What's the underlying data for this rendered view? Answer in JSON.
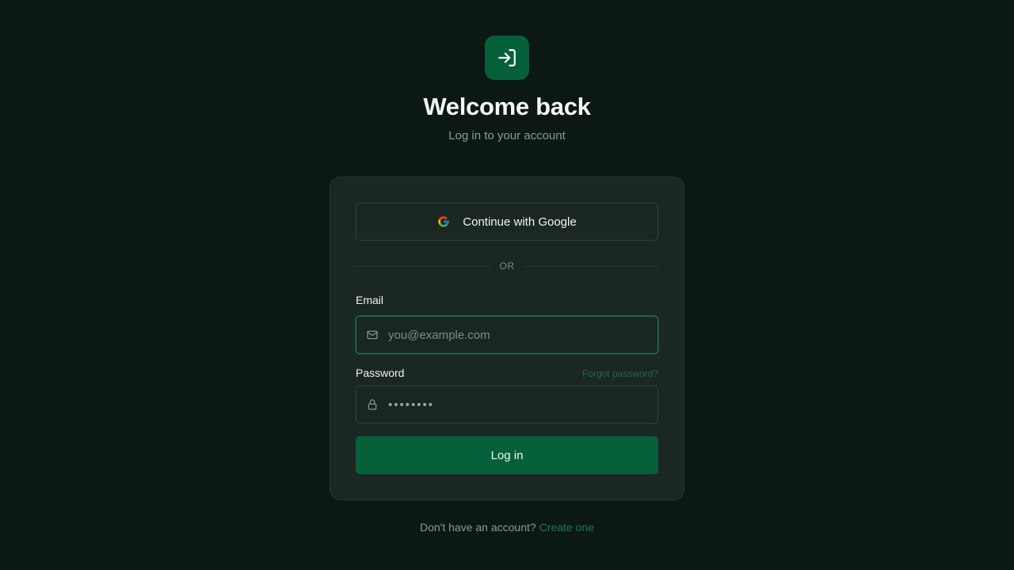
{
  "header": {
    "logo_icon": "login-arrow-icon",
    "title": "Welcome back",
    "subtitle": "Log in to your account"
  },
  "card": {
    "google_button": {
      "label": "Continue with Google",
      "icon": "google-icon"
    },
    "divider_label": "OR",
    "email": {
      "label": "Email",
      "placeholder": "you@example.com",
      "value": "",
      "icon": "mail-icon"
    },
    "password": {
      "label": "Password",
      "value": "password",
      "icon": "lock-icon",
      "forgot_label": "Forgot password?"
    },
    "submit_label": "Log in"
  },
  "footer": {
    "prompt": "Don't have an account?",
    "link_label": "Create one"
  },
  "colors": {
    "background": "#0b1814",
    "card": "#1b2723",
    "accent": "#05603a",
    "link": "#1f7a50"
  }
}
